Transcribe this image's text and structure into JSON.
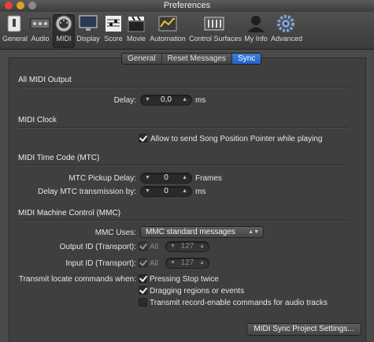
{
  "window": {
    "title": "Preferences"
  },
  "toolbar": {
    "items": [
      {
        "label": "General",
        "icon": "switch-icon"
      },
      {
        "label": "Audio",
        "icon": "audio-interface-icon"
      },
      {
        "label": "MIDI",
        "icon": "midi-connector-icon",
        "selected": true
      },
      {
        "label": "Display",
        "icon": "monitor-icon"
      },
      {
        "label": "Score",
        "icon": "score-icon"
      },
      {
        "label": "Movie",
        "icon": "clapperboard-icon"
      },
      {
        "label": "Automation",
        "icon": "automation-icon"
      },
      {
        "label": "Control Surfaces",
        "icon": "control-surface-icon"
      },
      {
        "label": "My Info",
        "icon": "person-icon"
      },
      {
        "label": "Advanced",
        "icon": "gear-icon"
      }
    ]
  },
  "tabs": [
    {
      "label": "General",
      "active": false
    },
    {
      "label": "Reset Messages",
      "active": false
    },
    {
      "label": "Sync",
      "active": true
    }
  ],
  "all_midi_output": {
    "title": "All MIDI Output",
    "delay_label": "Delay:",
    "delay_value": "0,0",
    "delay_unit": "ms"
  },
  "midi_clock": {
    "title": "MIDI Clock",
    "spp_label": "Allow to send Song Position Pointer while playing",
    "spp_checked": true
  },
  "mtc": {
    "title": "MIDI Time Code (MTC)",
    "pickup_label": "MTC Pickup Delay:",
    "pickup_value": "0",
    "pickup_unit": "Frames",
    "delay_label": "Delay MTC transmission by:",
    "delay_value": "0",
    "delay_unit": "ms"
  },
  "mmc": {
    "title": "MIDI Machine Control (MMC)",
    "uses_label": "MMC Uses:",
    "uses_value": "MMC standard messages",
    "output_label": "Output ID (Transport):",
    "output_all": "All",
    "output_value": "127",
    "input_label": "Input ID (Transport):",
    "input_all": "All",
    "input_value": "127",
    "transmit_label": "Transmit locate commands when:",
    "opt_stop": "Pressing Stop twice",
    "opt_drag": "Dragging regions or events",
    "opt_record": "Transmit record-enable commands for audio tracks"
  },
  "footer": {
    "sync_button": "MIDI Sync Project Settings..."
  }
}
